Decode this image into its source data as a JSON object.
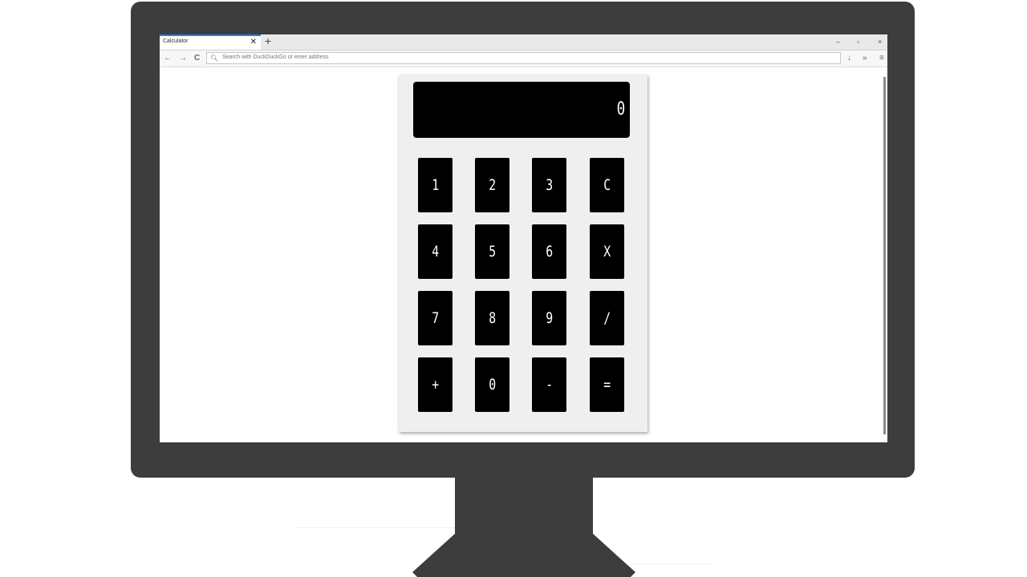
{
  "browser": {
    "tab_title": "Calculator",
    "tab_close_icon": "close-icon",
    "new_tab_label": "+",
    "window_controls": {
      "minimize": "–",
      "restore": "▫",
      "close": "×"
    },
    "nav": {
      "back": "←",
      "forward": "→",
      "reload": "C"
    },
    "search_placeholder": "Search with DuckDuckGo or enter address",
    "toolbar": {
      "download_icon": "↓",
      "overflow_icon": "»",
      "menu_icon": "≡"
    }
  },
  "calculator": {
    "display": "0",
    "keys": [
      [
        "1",
        "2",
        "3",
        "C"
      ],
      [
        "4",
        "5",
        "6",
        "X"
      ],
      [
        "7",
        "8",
        "9",
        "/"
      ],
      [
        "+",
        "0",
        "-",
        "="
      ]
    ]
  }
}
